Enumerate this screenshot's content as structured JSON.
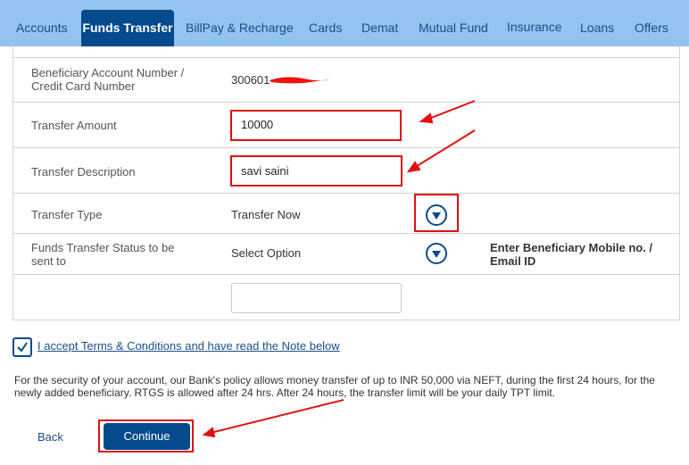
{
  "nav": {
    "tabs": [
      {
        "label": "Accounts"
      },
      {
        "label": "Funds Transfer",
        "active": true
      },
      {
        "label": "BillPay & Recharge"
      },
      {
        "label": "Cards"
      },
      {
        "label": "Demat"
      },
      {
        "label": "Mutual Fund"
      },
      {
        "label": "Insurance"
      },
      {
        "label": "Loans"
      },
      {
        "label": "Offers"
      }
    ]
  },
  "form": {
    "beneficiary_label": "Beneficiary Account Number / Credit Card Number",
    "beneficiary_value": "300601",
    "amount_label": "Transfer Amount",
    "amount_value": "10000",
    "description_label": "Transfer Description",
    "description_value": "savi saini",
    "type_label": "Transfer Type",
    "type_value": "Transfer Now",
    "status_label": "Funds Transfer Status to be sent to",
    "status_value": "Select Option",
    "mobile_label": "Enter Beneficiary Mobile no. / Email ID",
    "mobile_value": ""
  },
  "terms": {
    "label": "I accept Terms & Conditions and have read the Note below",
    "checked": true
  },
  "note": "For the security of your account, our Bank's policy allows money transfer of up to INR 50,000 via NEFT, during the first 24 hours, for the newly added beneficiary. RTGS is allowed after 24 hrs. After 24 hours, the transfer limit will be your daily TPT limit.",
  "actions": {
    "back": "Back",
    "continue": "Continue"
  },
  "colors": {
    "nav_bg": "#93c3f1",
    "primary": "#044a8c",
    "annotation": "#e01010"
  }
}
